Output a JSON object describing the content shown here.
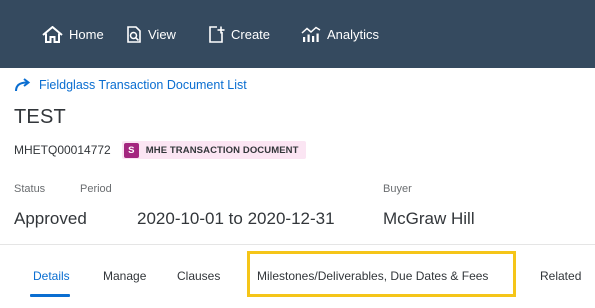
{
  "nav": {
    "home_label": "Home",
    "view_label": "View",
    "create_label": "Create",
    "analytics_label": "Analytics"
  },
  "breadcrumb": {
    "label": "Fieldglass Transaction Document List"
  },
  "document": {
    "title": "TEST",
    "id": "MHETQ00014772",
    "type_badge": "S",
    "type_label": "MHE TRANSACTION DOCUMENT"
  },
  "attributes": {
    "status_label": "Status",
    "status_value": "Approved",
    "period_label": "Period",
    "period_value": "2020-10-01 to 2020-12-31",
    "buyer_label": "Buyer",
    "buyer_value": "McGraw Hill"
  },
  "tabs": [
    {
      "label": "Details"
    },
    {
      "label": "Manage"
    },
    {
      "label": "Clauses"
    },
    {
      "label": "Milestones/Deliverables, Due Dates & Fees"
    },
    {
      "label": "Related"
    }
  ],
  "colors": {
    "navbar": "#354a5f",
    "link": "#0a6ed1",
    "badge": "#a4267f",
    "badge_tag_bg": "#fbe5f3",
    "highlight": "#f5c518"
  }
}
